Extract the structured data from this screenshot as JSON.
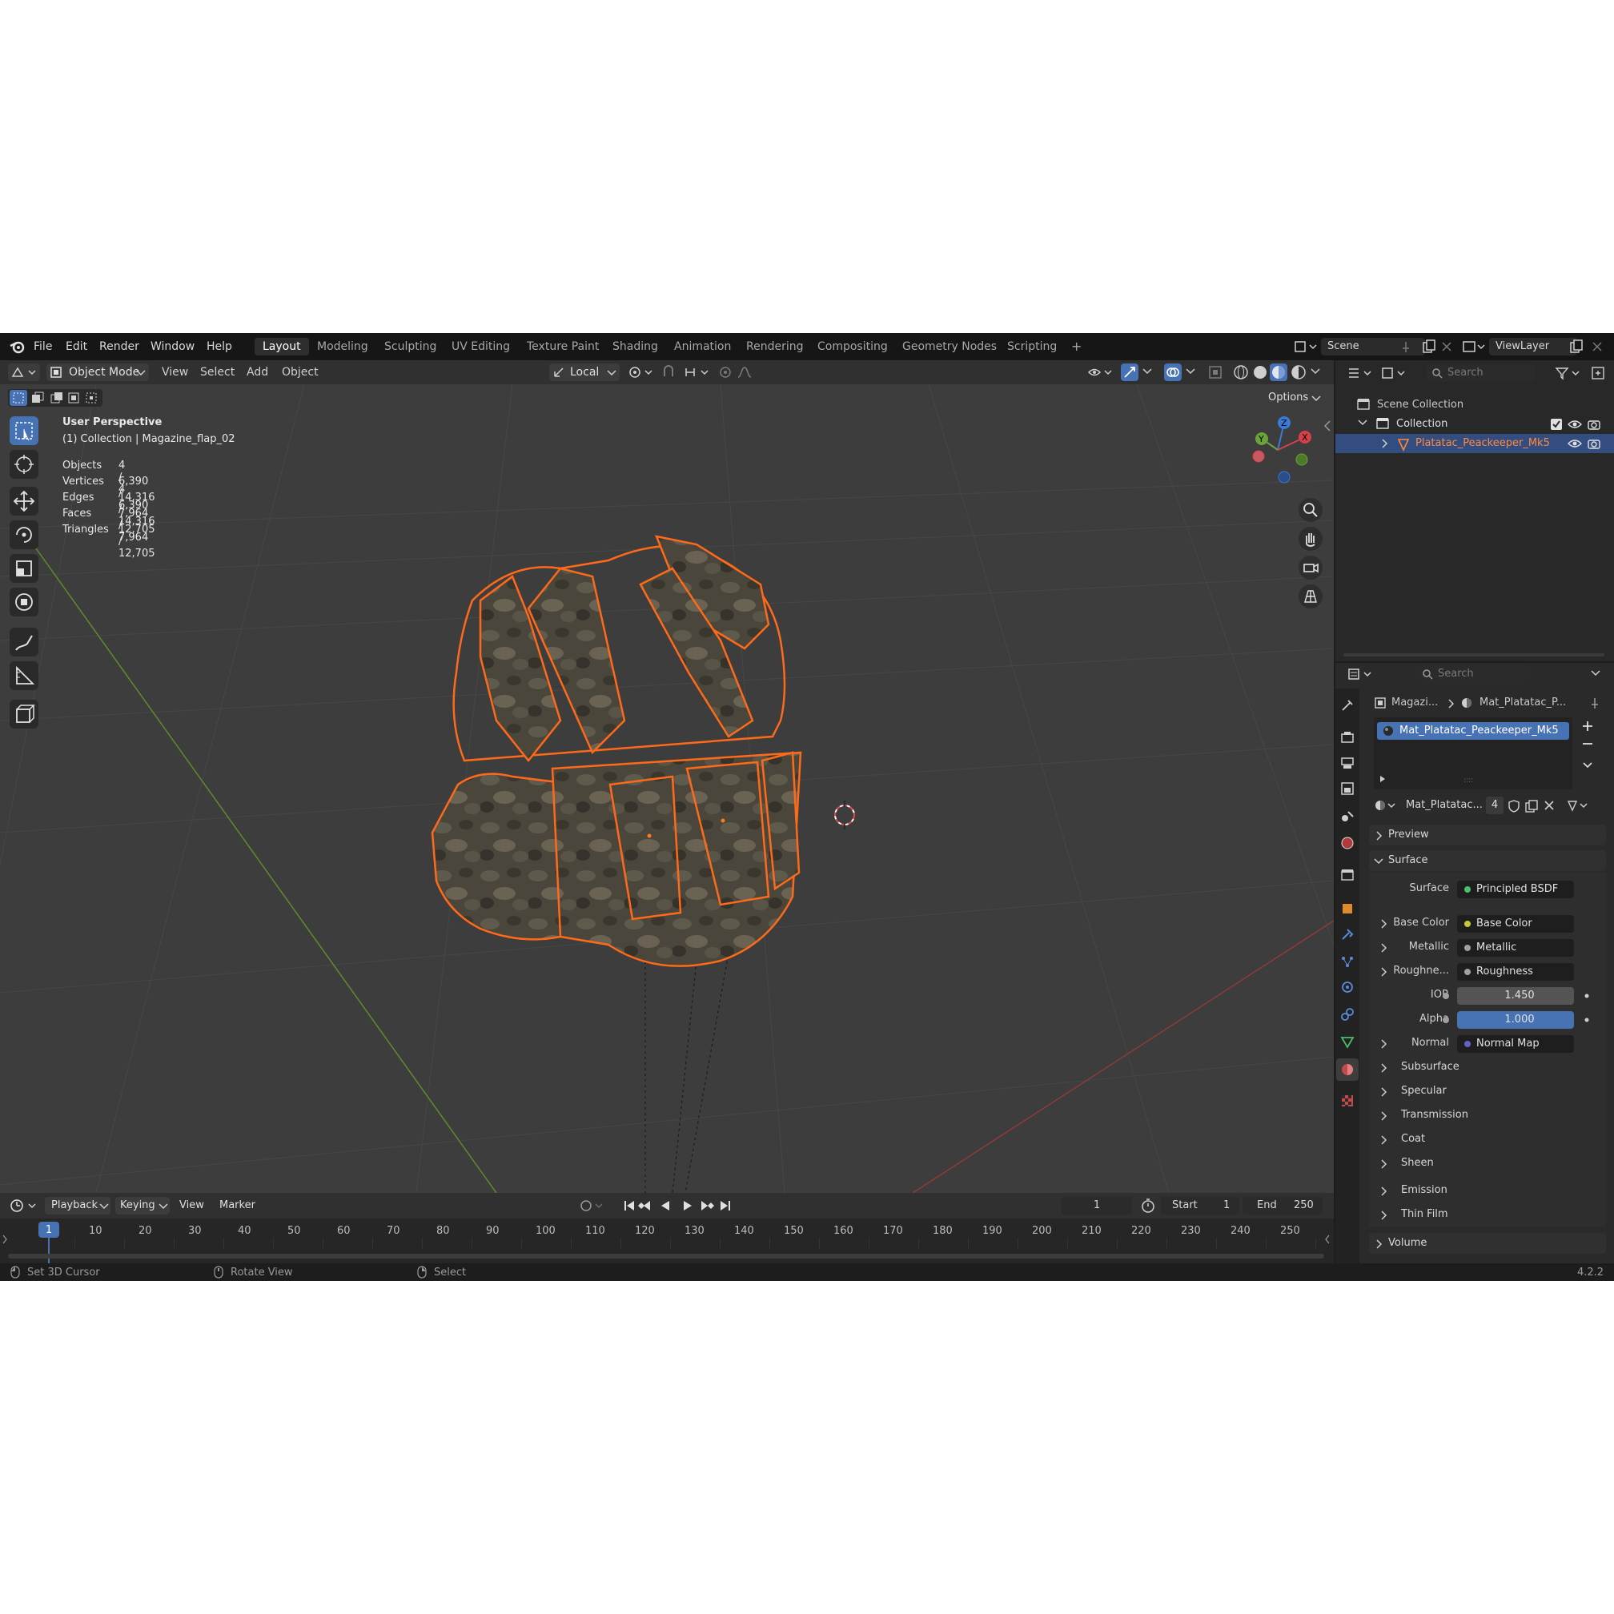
{
  "topbar": {
    "menus": [
      "File",
      "Edit",
      "Render",
      "Window",
      "Help"
    ],
    "workspaces": [
      "Layout",
      "Modeling",
      "Sculpting",
      "UV Editing",
      "Texture Paint",
      "Shading",
      "Animation",
      "Rendering",
      "Compositing",
      "Geometry Nodes",
      "Scripting"
    ],
    "active_workspace": "Layout",
    "add_tab": "+",
    "scene": "Scene",
    "view_layer": "ViewLayer"
  },
  "viewport_header": {
    "mode": "Object Mode",
    "menus": [
      "View",
      "Select",
      "Add",
      "Object"
    ],
    "transform_orientation": "Local",
    "options": "Options"
  },
  "overlay": {
    "perspective": "User Perspective",
    "collection_line": "(1) Collection | Magazine_flap_02",
    "stats": [
      {
        "label": "Objects",
        "value": "4 / 4"
      },
      {
        "label": "Vertices",
        "value": "6,390 / 6,390"
      },
      {
        "label": "Edges",
        "value": "14,316 / 14,316"
      },
      {
        "label": "Faces",
        "value": "7,964 / 7,964"
      },
      {
        "label": "Triangles",
        "value": "12,705 / 12,705"
      }
    ]
  },
  "gizmo": {
    "z": "Z",
    "y": "Y",
    "x": "X"
  },
  "outliner": {
    "search_placeholder": "Search",
    "scene_collection": "Scene Collection",
    "collection": "Collection",
    "object": "Platatac_Peackeeper_Mk5"
  },
  "properties": {
    "search_placeholder": "Search",
    "breadcrumb_object": "Magazi...",
    "breadcrumb_material": "Mat_Platatac_P...",
    "material_slot": "Mat_Platatac_Peackeeper_Mk5",
    "material_name": "Mat_Platatac...",
    "user_count": "4",
    "sections": {
      "preview": "Preview",
      "surface": "Surface",
      "volume": "Volume"
    },
    "surface_row": {
      "label": "Surface",
      "value": "Principled BSDF"
    },
    "inputs": [
      {
        "label": "Base Color",
        "value": "Base Color",
        "dot": "#c8c83a",
        "expander": true
      },
      {
        "label": "Metallic",
        "value": "Metallic",
        "dot": "#a0a0a0",
        "expander": true
      },
      {
        "label": "Roughne...",
        "value": "Roughness",
        "dot": "#a0a0a0",
        "expander": true
      },
      {
        "label": "IOR",
        "value": "1.450",
        "dot": "#a0a0a0",
        "expander": false
      },
      {
        "label": "Alpha",
        "value": "1.000",
        "dot": "#a0a0a0",
        "expander": false,
        "highlight": true
      },
      {
        "label": "Normal",
        "value": "Normal Map",
        "dot": "#6363c7",
        "expander": true
      }
    ],
    "subpanels": [
      "Subsurface",
      "Specular",
      "Transmission",
      "Coat",
      "Sheen",
      "Emission",
      "Thin Film"
    ]
  },
  "timeline": {
    "menus": [
      "Playback",
      "Keying",
      "View",
      "Marker"
    ],
    "current_frame": "1",
    "start_label": "Start",
    "start": "1",
    "end_label": "End",
    "end": "250",
    "ticks": [
      "1",
      "10",
      "20",
      "30",
      "40",
      "50",
      "60",
      "70",
      "80",
      "90",
      "100",
      "110",
      "120",
      "130",
      "140",
      "150",
      "160",
      "170",
      "180",
      "190",
      "200",
      "210",
      "220",
      "230",
      "240",
      "250"
    ]
  },
  "statusbar": {
    "hints": [
      "Set 3D Cursor",
      "Rotate View",
      "Select"
    ],
    "version": "4.2.2"
  },
  "colors": {
    "accent": "#4772b3",
    "selection": "#ff7020",
    "background": "#3d3d3d"
  }
}
